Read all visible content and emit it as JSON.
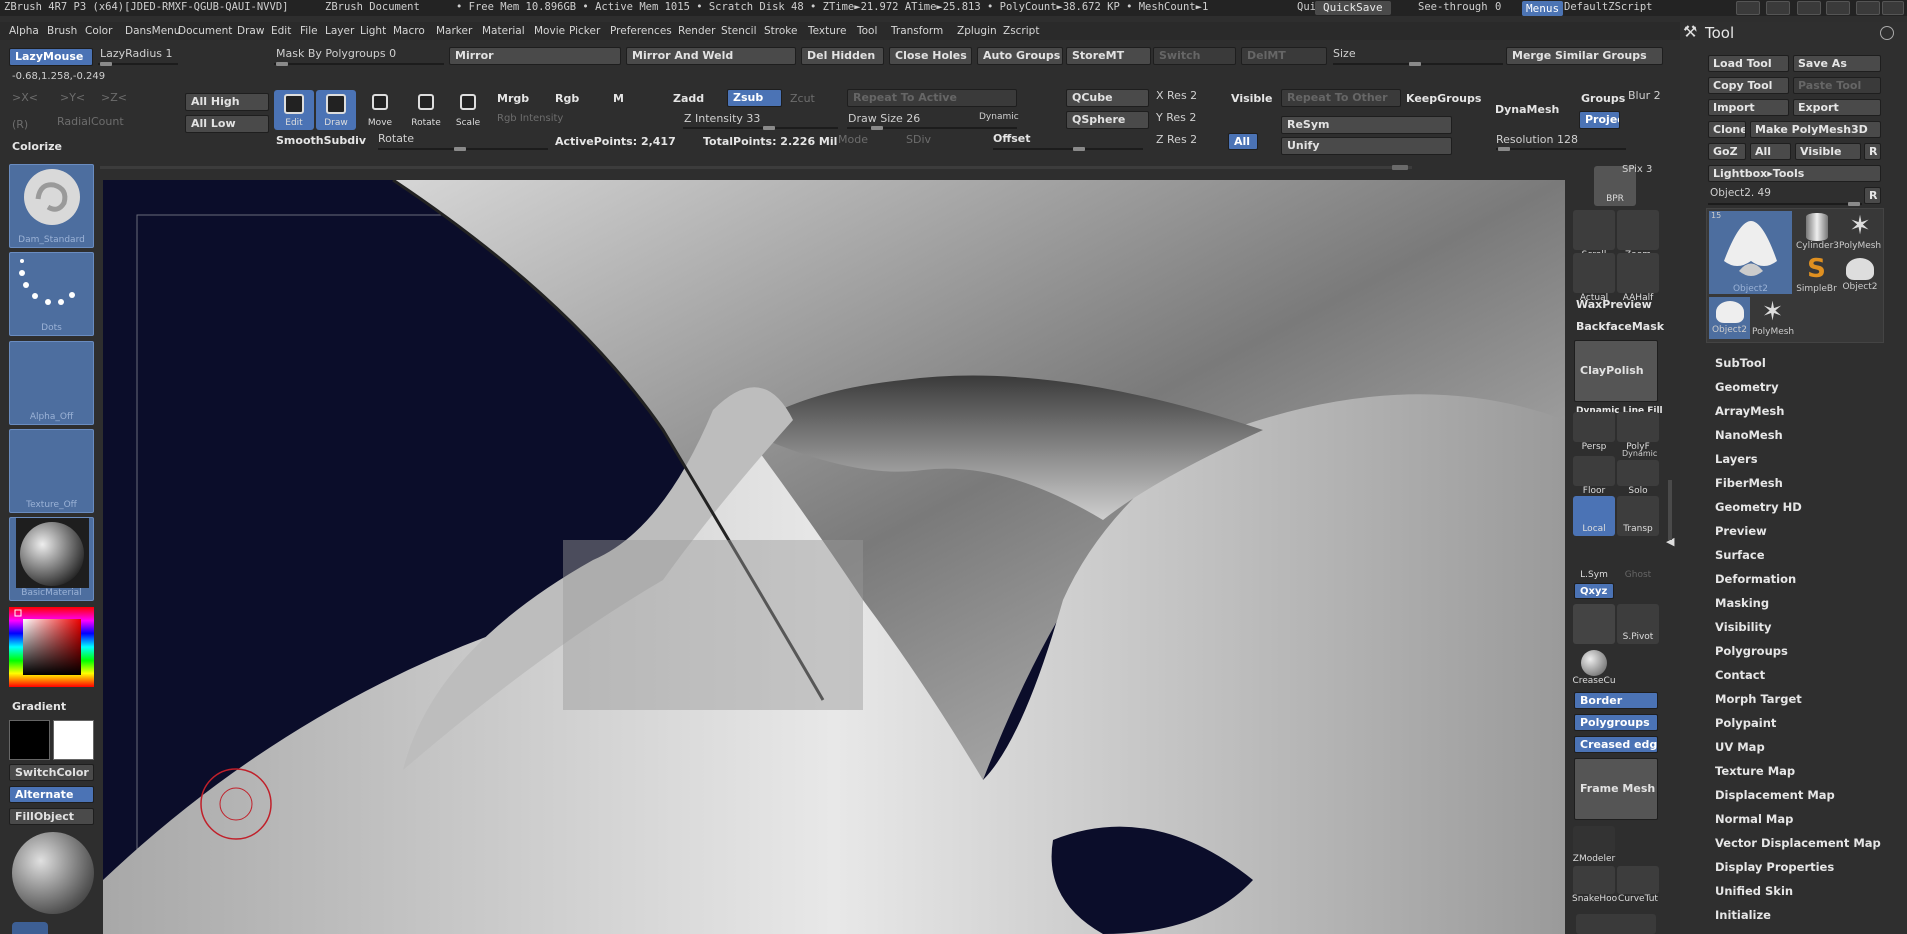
{
  "titlebar": {
    "app": "ZBrush 4R7 P3 (x64)[JDED-RMXF-QGUB-QAUI-NVVD]",
    "doc": "ZBrush Document",
    "stats": "• Free Mem 10.896GB • Active Mem 1015 • Scratch Disk 48 • ZTime►21.972 ATime►25.813 • PolyCount►38.672 KP • MeshCount►1",
    "quic": "Quic",
    "quicksave": "QuickSave",
    "see_through": "See-through",
    "see_through_val": "0",
    "menus": "Menus",
    "default_zscript": "DefaultZScript"
  },
  "menubar": [
    "Alpha",
    "Brush",
    "Color",
    "DansMenu",
    "Document",
    "Draw",
    "Edit",
    "File",
    "Layer",
    "Light",
    "Macro",
    "Marker",
    "Material",
    "Movie",
    "Picker",
    "Preferences",
    "Render",
    "Stencil",
    "Stroke",
    "Texture",
    "Tool",
    "Transform",
    "Zplugin",
    "Zscript"
  ],
  "top": {
    "lazymouse": "LazyMouse",
    "lazyradius": "LazyRadius 1",
    "coords": "-0.68,1.258,-0.249",
    "sym_x": ">X<",
    "sym_y": ">Y<",
    "sym_z": ">Z<",
    "r": "(R)",
    "radialcount": "RadialCount",
    "mask_by_polygroups": "Mask By Polygroups 0",
    "mirror": "Mirror",
    "mirror_weld": "Mirror And Weld",
    "del_hidden": "Del Hidden",
    "close_holes": "Close Holes",
    "auto_groups": "Auto Groups",
    "storemt": "StoreMT",
    "switch": "Switch",
    "delmt": "DelMT",
    "size": "Size",
    "merge_similar": "Merge Similar Groups",
    "all_high": "All High",
    "all_low": "All Low",
    "edit": "Edit",
    "draw": "Draw",
    "move": "Move",
    "rotate": "Rotate",
    "scale": "Scale",
    "mrgb": "Mrgb",
    "rgb": "Rgb",
    "m": "M",
    "zadd": "Zadd",
    "zsub": "Zsub",
    "zcut": "Zcut",
    "rgb_intensity": "Rgb Intensity",
    "z_intensity": "Z Intensity 33",
    "repeat_active": "Repeat To Active",
    "draw_size": "Draw Size 26",
    "dynamic": "Dynamic",
    "qcube": "QCube",
    "qsphere": "QSphere",
    "xres": "X Res 2",
    "yres": "Y Res 2",
    "zres": "Z Res 2",
    "visible": "Visible",
    "repeat_other": "Repeat To Other",
    "keepgroups": "KeepGroups",
    "dynamesh": "DynaMesh",
    "groups": "Groups",
    "blur": "Blur 2",
    "projec": "Projec",
    "resym": "ReSym",
    "unify": "Unify",
    "all": "All",
    "resolution": "Resolution 128",
    "colorize": "Colorize",
    "smoothsubdiv": "SmoothSubdiv",
    "rotate2": "Rotate",
    "active_points": "ActivePoints: 2,417",
    "total_points": "TotalPoints: 2.226 Mil",
    "mode": "Mode",
    "sdiv": "SDiv",
    "offset": "Offset"
  },
  "left": {
    "brush": "Dam_Standard",
    "stroke": "Dots",
    "alpha": "Alpha_Off",
    "texture": "Texture_Off",
    "material": "BasicMaterial",
    "gradient": "Gradient",
    "switchcolor": "SwitchColor",
    "alternate": "Alternate",
    "fillobject": "FillObject"
  },
  "shelf": {
    "bpr": "BPR",
    "spix": "SPix 3",
    "scroll": "Scroll",
    "zoom": "Zoom",
    "actual": "Actual",
    "aahalf": "AAHalf",
    "waxpreview": "WaxPreview",
    "backfacemask": "BackfaceMask",
    "claypolish": "ClayPolish",
    "dynamic_line_fill": "Dynamic Line Fill",
    "persp": "Persp",
    "polyf": "PolyF",
    "floor": "Floor",
    "solo_dyn": "Dynamic",
    "solo": "Solo",
    "local": "Local",
    "transp": "Transp",
    "lsym": "L.Sym",
    "ghost": "Ghost",
    "xyz": "Qxyz",
    "spivot": "S.Pivot",
    "creasecu": "CreaseCu",
    "border": "Border",
    "polygroups": "Polygroups",
    "creased_edges": "Creased edges",
    "frame_mesh": "Frame Mesh",
    "zmodeler": "ZModeler",
    "snakehook": "SnakeHoo",
    "curvetube": "CurveTut"
  },
  "tool": {
    "title": "Tool",
    "load_tool": "Load Tool",
    "save_as": "Save As",
    "copy_tool": "Copy Tool",
    "paste_tool": "Paste Tool",
    "import": "Import",
    "export": "Export",
    "clone": "Clone",
    "make_polymesh": "Make PolyMesh3D",
    "goz": "GoZ",
    "all": "All",
    "visible": "Visible",
    "r": "R",
    "lightbox_tools": "Lightbox▸Tools",
    "object_slider": "Object2. 49",
    "r2": "R",
    "thumbs": [
      "Object2",
      "Cylinder3",
      "PolyMesh",
      "SimpleBr",
      "Object2",
      "Object2",
      "PolyMesh"
    ],
    "thumb_badge": "15",
    "items": [
      "SubTool",
      "Geometry",
      "ArrayMesh",
      "NanoMesh",
      "Layers",
      "FiberMesh",
      "Geometry HD",
      "Preview",
      "Surface",
      "Deformation",
      "Masking",
      "Visibility",
      "Polygroups",
      "Contact",
      "Morph Target",
      "Polypaint",
      "UV Map",
      "Texture Map",
      "Displacement Map",
      "Normal Map",
      "Vector Displacement Map",
      "Display Properties",
      "Unified Skin",
      "Initialize"
    ]
  },
  "colors": {
    "accent": "#4b73b5",
    "canvas": "#0b0d2a",
    "panel": "#2e2e2e",
    "button": "#4a4a4a"
  }
}
